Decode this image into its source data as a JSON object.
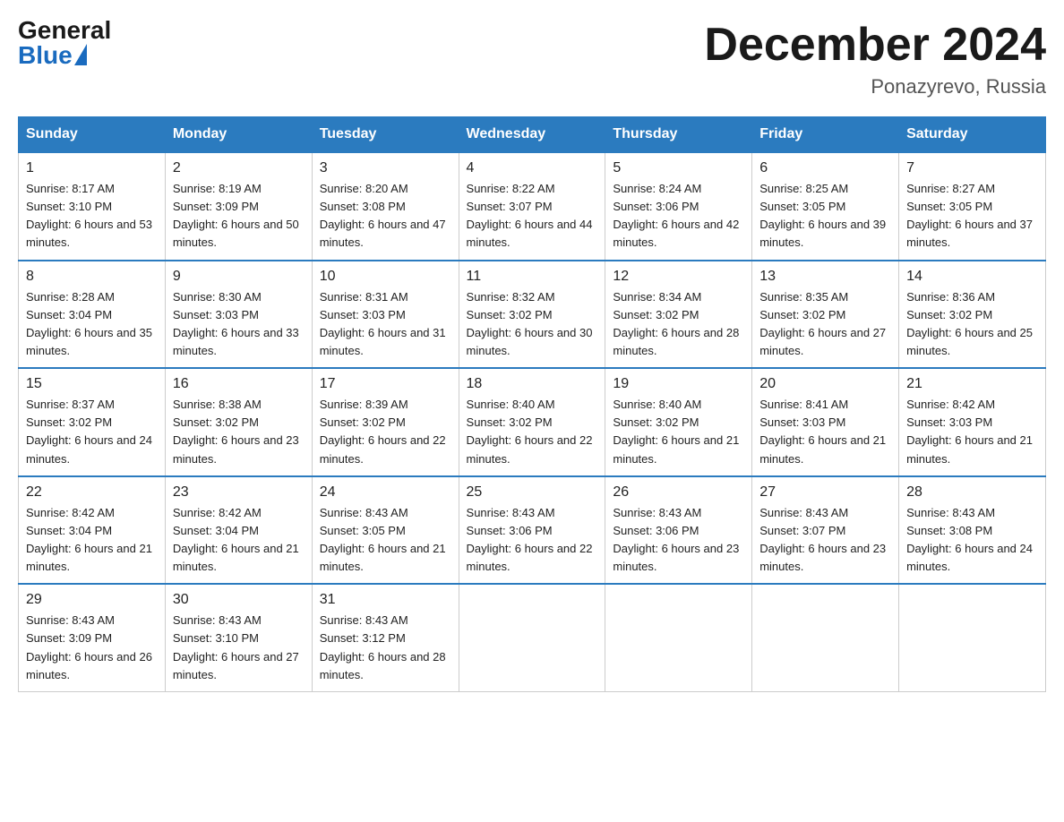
{
  "header": {
    "logo_general": "General",
    "logo_blue": "Blue",
    "month_title": "December 2024",
    "location": "Ponazyrevo, Russia"
  },
  "weekdays": [
    "Sunday",
    "Monday",
    "Tuesday",
    "Wednesday",
    "Thursday",
    "Friday",
    "Saturday"
  ],
  "weeks": [
    [
      {
        "day": "1",
        "sunrise": "8:17 AM",
        "sunset": "3:10 PM",
        "daylight": "6 hours and 53 minutes."
      },
      {
        "day": "2",
        "sunrise": "8:19 AM",
        "sunset": "3:09 PM",
        "daylight": "6 hours and 50 minutes."
      },
      {
        "day": "3",
        "sunrise": "8:20 AM",
        "sunset": "3:08 PM",
        "daylight": "6 hours and 47 minutes."
      },
      {
        "day": "4",
        "sunrise": "8:22 AM",
        "sunset": "3:07 PM",
        "daylight": "6 hours and 44 minutes."
      },
      {
        "day": "5",
        "sunrise": "8:24 AM",
        "sunset": "3:06 PM",
        "daylight": "6 hours and 42 minutes."
      },
      {
        "day": "6",
        "sunrise": "8:25 AM",
        "sunset": "3:05 PM",
        "daylight": "6 hours and 39 minutes."
      },
      {
        "day": "7",
        "sunrise": "8:27 AM",
        "sunset": "3:05 PM",
        "daylight": "6 hours and 37 minutes."
      }
    ],
    [
      {
        "day": "8",
        "sunrise": "8:28 AM",
        "sunset": "3:04 PM",
        "daylight": "6 hours and 35 minutes."
      },
      {
        "day": "9",
        "sunrise": "8:30 AM",
        "sunset": "3:03 PM",
        "daylight": "6 hours and 33 minutes."
      },
      {
        "day": "10",
        "sunrise": "8:31 AM",
        "sunset": "3:03 PM",
        "daylight": "6 hours and 31 minutes."
      },
      {
        "day": "11",
        "sunrise": "8:32 AM",
        "sunset": "3:02 PM",
        "daylight": "6 hours and 30 minutes."
      },
      {
        "day": "12",
        "sunrise": "8:34 AM",
        "sunset": "3:02 PM",
        "daylight": "6 hours and 28 minutes."
      },
      {
        "day": "13",
        "sunrise": "8:35 AM",
        "sunset": "3:02 PM",
        "daylight": "6 hours and 27 minutes."
      },
      {
        "day": "14",
        "sunrise": "8:36 AM",
        "sunset": "3:02 PM",
        "daylight": "6 hours and 25 minutes."
      }
    ],
    [
      {
        "day": "15",
        "sunrise": "8:37 AM",
        "sunset": "3:02 PM",
        "daylight": "6 hours and 24 minutes."
      },
      {
        "day": "16",
        "sunrise": "8:38 AM",
        "sunset": "3:02 PM",
        "daylight": "6 hours and 23 minutes."
      },
      {
        "day": "17",
        "sunrise": "8:39 AM",
        "sunset": "3:02 PM",
        "daylight": "6 hours and 22 minutes."
      },
      {
        "day": "18",
        "sunrise": "8:40 AM",
        "sunset": "3:02 PM",
        "daylight": "6 hours and 22 minutes."
      },
      {
        "day": "19",
        "sunrise": "8:40 AM",
        "sunset": "3:02 PM",
        "daylight": "6 hours and 21 minutes."
      },
      {
        "day": "20",
        "sunrise": "8:41 AM",
        "sunset": "3:03 PM",
        "daylight": "6 hours and 21 minutes."
      },
      {
        "day": "21",
        "sunrise": "8:42 AM",
        "sunset": "3:03 PM",
        "daylight": "6 hours and 21 minutes."
      }
    ],
    [
      {
        "day": "22",
        "sunrise": "8:42 AM",
        "sunset": "3:04 PM",
        "daylight": "6 hours and 21 minutes."
      },
      {
        "day": "23",
        "sunrise": "8:42 AM",
        "sunset": "3:04 PM",
        "daylight": "6 hours and 21 minutes."
      },
      {
        "day": "24",
        "sunrise": "8:43 AM",
        "sunset": "3:05 PM",
        "daylight": "6 hours and 21 minutes."
      },
      {
        "day": "25",
        "sunrise": "8:43 AM",
        "sunset": "3:06 PM",
        "daylight": "6 hours and 22 minutes."
      },
      {
        "day": "26",
        "sunrise": "8:43 AM",
        "sunset": "3:06 PM",
        "daylight": "6 hours and 23 minutes."
      },
      {
        "day": "27",
        "sunrise": "8:43 AM",
        "sunset": "3:07 PM",
        "daylight": "6 hours and 23 minutes."
      },
      {
        "day": "28",
        "sunrise": "8:43 AM",
        "sunset": "3:08 PM",
        "daylight": "6 hours and 24 minutes."
      }
    ],
    [
      {
        "day": "29",
        "sunrise": "8:43 AM",
        "sunset": "3:09 PM",
        "daylight": "6 hours and 26 minutes."
      },
      {
        "day": "30",
        "sunrise": "8:43 AM",
        "sunset": "3:10 PM",
        "daylight": "6 hours and 27 minutes."
      },
      {
        "day": "31",
        "sunrise": "8:43 AM",
        "sunset": "3:12 PM",
        "daylight": "6 hours and 28 minutes."
      },
      null,
      null,
      null,
      null
    ]
  ]
}
